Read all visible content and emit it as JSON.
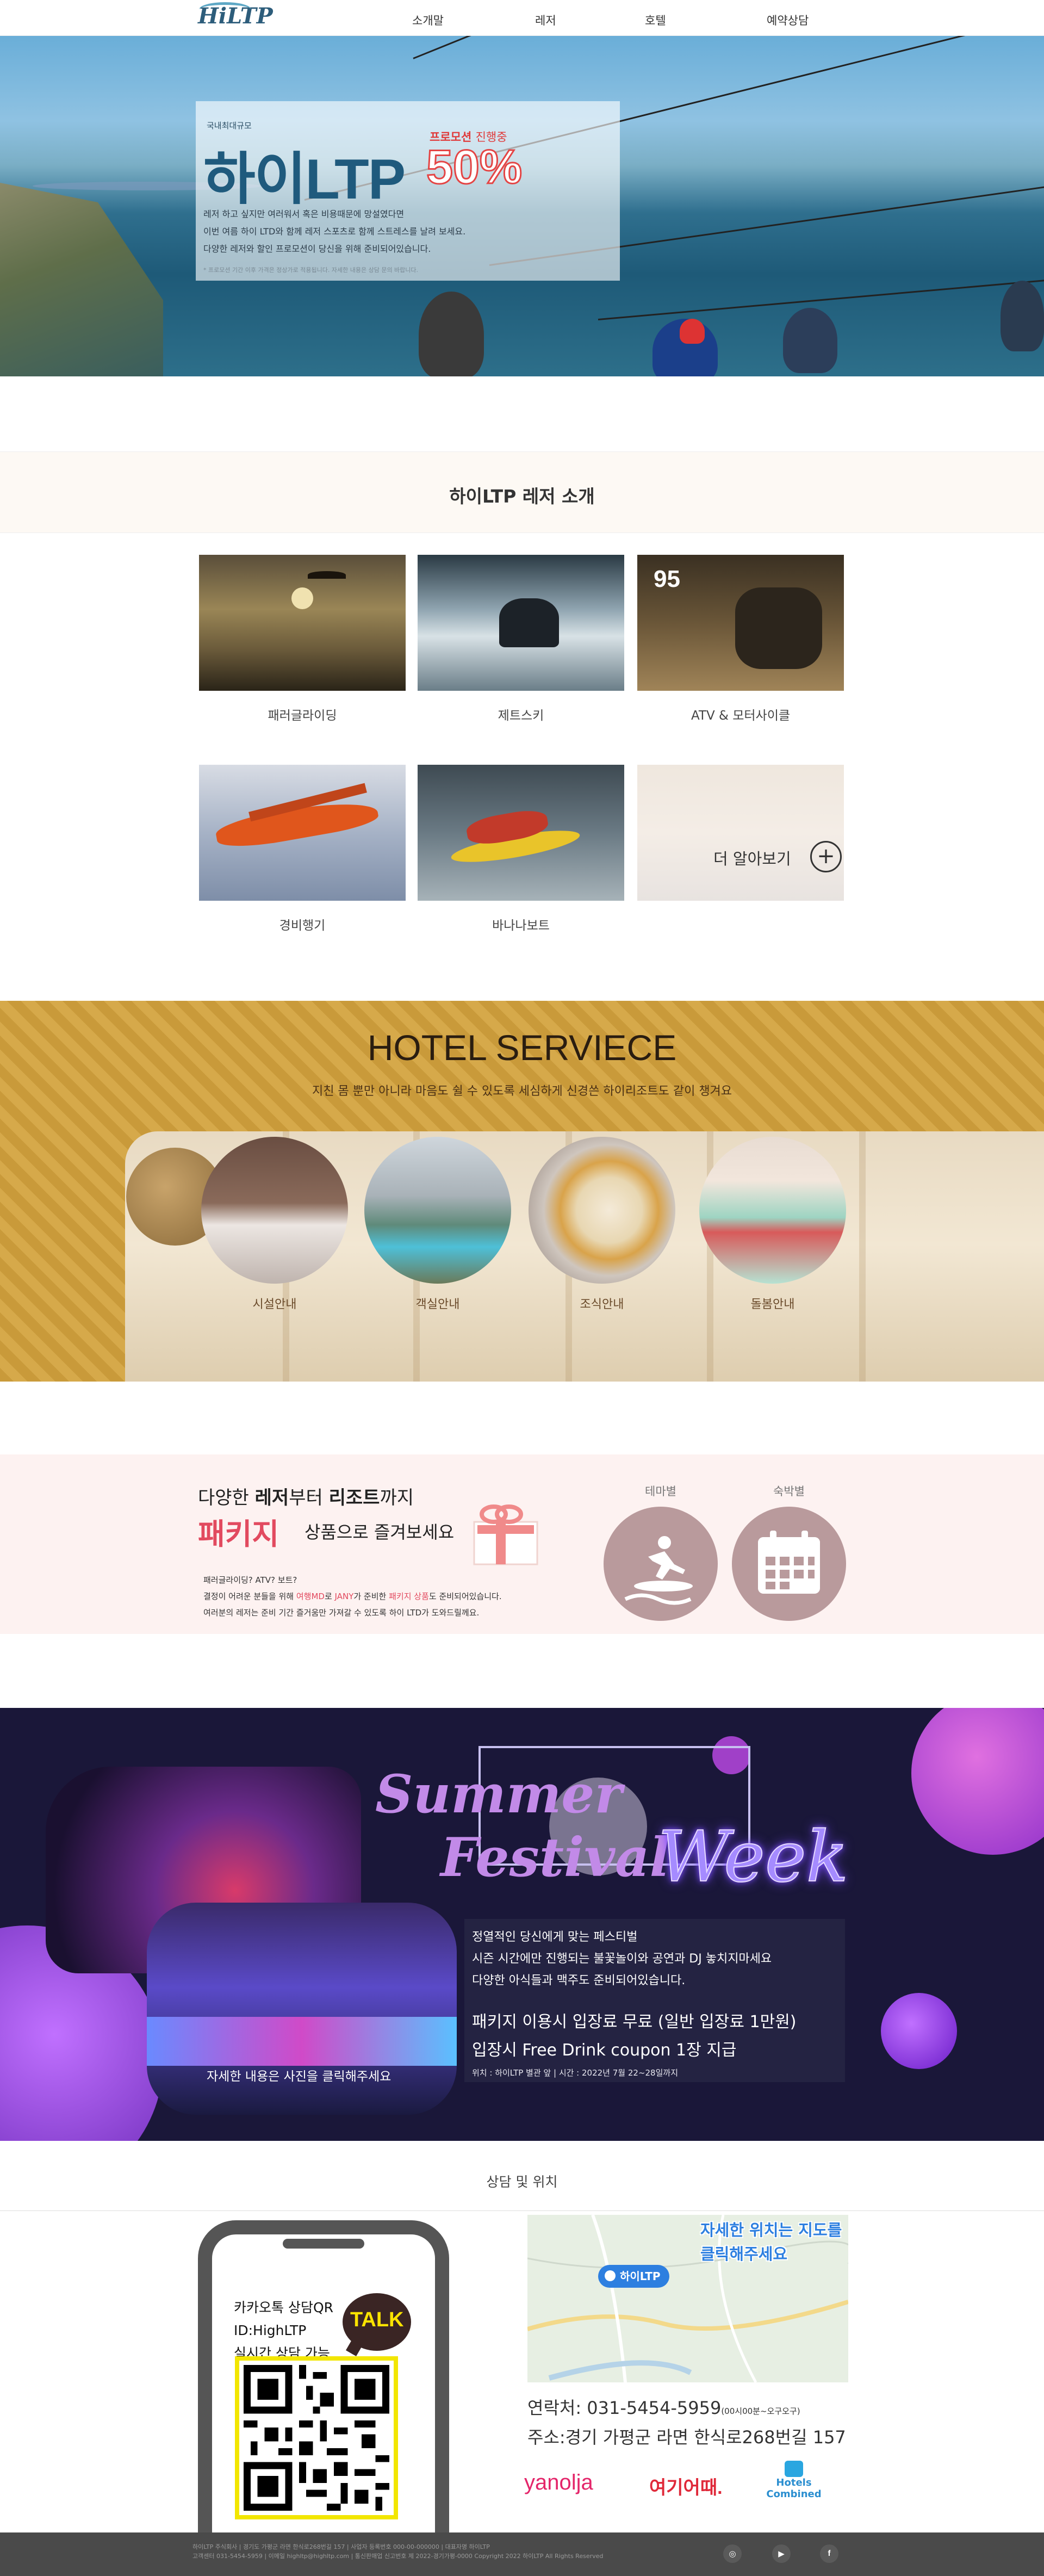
{
  "nav": {
    "logo": "HiLTP",
    "items": [
      "소개말",
      "레저",
      "호텔",
      "예약상담"
    ]
  },
  "hero": {
    "small": "국내최대규모",
    "title": "하이LTP",
    "promo_a": "프로모션",
    "promo_b": "진행중",
    "percent": "50%",
    "desc": [
      "레저 하고 싶지만 여러워서 혹은 비용때문에 망설였다면",
      "이번 여름 하이 LTD와 함께 레저 스포츠로 함께 스트레스를 날려 보세요.",
      "다양한 레저와 할인 프로모션이 당신을 위해 준비되어있습니다."
    ],
    "note": "* 프로모션 기간 이후 가격은 정상가로 적용됩니다. 자세한 내용은 상담 문의 바랍니다."
  },
  "leisure": {
    "title": "하이LTP 레저 소개",
    "items": [
      "패러글라이딩",
      "제트스키",
      "ATV & 모터사이클",
      "경비행기",
      "바나나보트"
    ],
    "more": "더 알아보기"
  },
  "hotel": {
    "title": "HOTEL SERVIECE",
    "subtitle": "지친 몸 뿐만 아니라 마음도 쉴 수 있도록 세심하게 신경쓴 하이리조트도 같이 챙겨요",
    "items": [
      "시설안내",
      "객실안내",
      "조식안내",
      "돌봄안내"
    ]
  },
  "package": {
    "line1_a": "다양한 ",
    "line1_b": "레저",
    "line1_c": "부터 ",
    "line1_d": "리조트",
    "line1_e": "까지",
    "big": "패키지",
    "line2": "상품으로 즐겨보세요",
    "desc1": "패러글라이딩? ATV? 보트?",
    "desc2_a": "결정이 어려운 분들을 위해 ",
    "desc2_b": "여행MD",
    "desc2_c": "로 ",
    "desc2_d": "JANY",
    "desc2_e": "가 준비한 ",
    "desc2_f": "패키지 상품",
    "desc2_g": "도 준비되어있습니다.",
    "desc3": "여러분의 레저는 준비 기간 즐거움만 가져갈 수 있도록 하이 LTD가 도와드릴께요.",
    "theme": "테마별",
    "stay": "숙박별"
  },
  "summer": {
    "word1": "Summer",
    "word2": "Festival",
    "word3": "Week",
    "dj_caption": "자세한 내용은 사진을 클릭해주세요",
    "t1": [
      "정열적인 당신에게 맞는 페스티벌",
      "시즌 시간에만 진행되는 불꽃놀이와 공연과 DJ 놓치지마세요",
      "다양한 아식들과 맥주도 준비되어있습니다."
    ],
    "t2": [
      "패키지 이용시 입장료 무료 (일반 입장료 1만원)",
      "입장시 Free Drink coupon 1장 지급"
    ],
    "t3": "위치 : 하이LTP 별관 앞 | 시간 : 2022년 7월 22~28일까지"
  },
  "contact": {
    "title": "상담 및 위치",
    "phone_lines": [
      "카카오톡 상담QR",
      "ID:HighLTP",
      "실시간 상담 가능"
    ],
    "talk": "TALK",
    "map_text": [
      "자세한 위치는 지도를",
      "클릭해주세요"
    ],
    "map_pin": "하이LTP",
    "tel_label": "연락처: 031-5454-5959",
    "tel_hours": "(00시00분~오구오구)",
    "address": "주소:경기 가평군 라면 한식로268번길 157",
    "brands": [
      "yanolja",
      "여기어때.",
      "Hotels",
      "Combined"
    ]
  },
  "footer": {
    "lines": [
      "하이LTP 주식회사 | 경기도 가평군 라면 한식로268번길 157 | 사업자 등록번호 000-00-000000 | 대표자명 하이LTP",
      "고객센터 031-5454-5959 | 이메일 highltp@highltp.com | 통신판매업 신고번호 제 2022-경기가평-0000 Copyright 2022 하이LTP All Rights Reserved"
    ],
    "icons": [
      "instagram-icon",
      "youtube-icon",
      "facebook-icon"
    ]
  },
  "colors": {
    "hero_title": "#1f5a7d",
    "promo_red": "#e03a3a",
    "package_pink": "#e24a5f",
    "summer_bg": "#1a1739",
    "kakao_yellow": "#f2e600"
  }
}
